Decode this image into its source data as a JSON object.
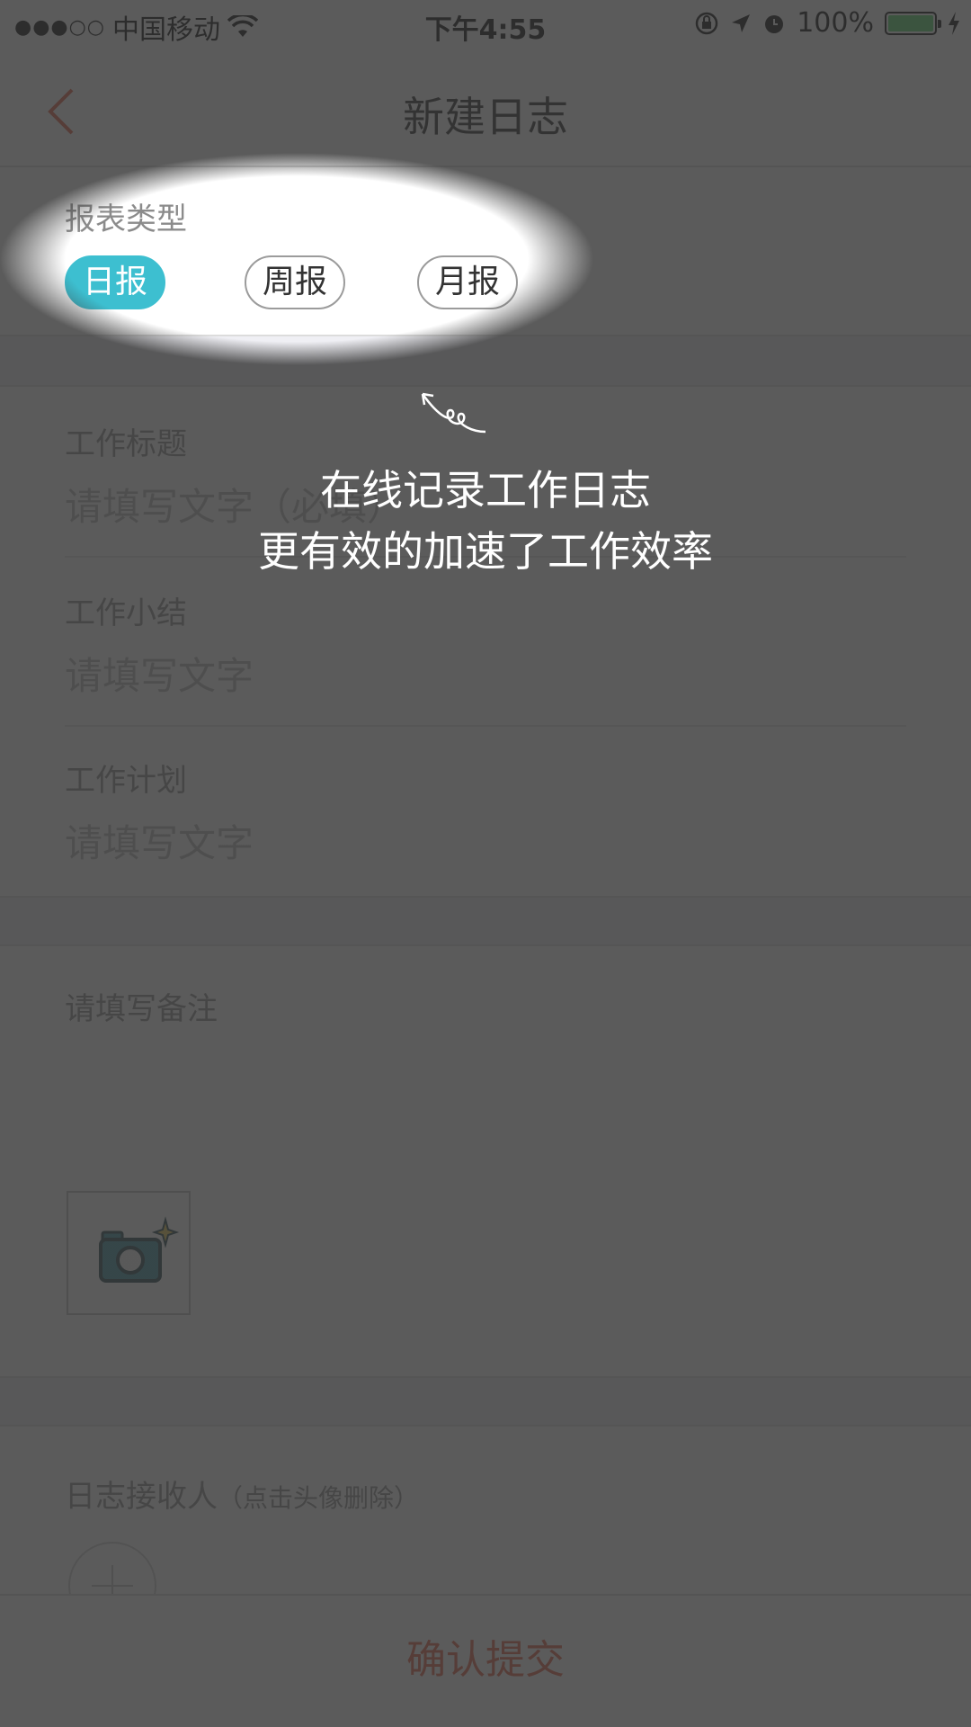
{
  "status_bar": {
    "carrier": "中国移动",
    "time": "下午4:55",
    "battery": "100%",
    "battery_level": 1.0,
    "signal_icon": "signal-dots-icon",
    "wifi_icon": "wifi-icon"
  },
  "nav": {
    "title": "新建日志",
    "back_icon": "chevron-left-icon"
  },
  "report_type": {
    "label": "报表类型",
    "options": [
      "日报",
      "周报",
      "月报"
    ],
    "selected": "日报"
  },
  "fields": {
    "title_label": "工作标题",
    "title_placeholder": "请填写文字（必填）",
    "summary_label": "工作小结",
    "summary_placeholder": "请填写文字",
    "plan_label": "工作计划",
    "plan_placeholder": "请填写文字",
    "remark_placeholder": "请填写备注"
  },
  "recipients": {
    "label": "日志接收人",
    "hint": "（点击头像删除）"
  },
  "submit_label": "确认提交",
  "guide": {
    "line1": "在线记录工作日志",
    "line2": "更有效的加速了工作效率"
  },
  "colors": {
    "accent": "#3dbfd0",
    "submit_text": "#e0573a",
    "overlay": "rgba(55,55,55,0.82)"
  }
}
